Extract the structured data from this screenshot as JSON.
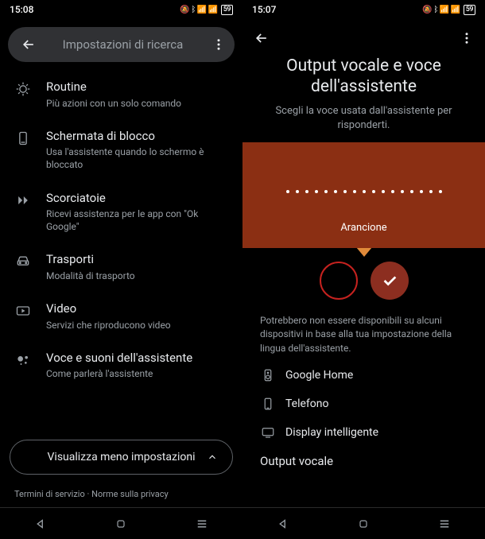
{
  "left": {
    "status": {
      "time": "15:08",
      "battery": "59"
    },
    "search_title": "Impostazioni di ricerca",
    "items": [
      {
        "icon": "routines",
        "title": "Routine",
        "subtitle": "Più azioni con un solo comando"
      },
      {
        "icon": "lock-screen",
        "title": "Schermata di blocco",
        "subtitle": "Usa l'assistente quando lo schermo è bloccato"
      },
      {
        "icon": "shortcuts",
        "title": "Scorciatoie",
        "subtitle": "Ricevi assistenza per le app con \"Ok Google\""
      },
      {
        "icon": "car",
        "title": "Trasporti",
        "subtitle": "Modalità di trasporto"
      },
      {
        "icon": "video",
        "title": "Video",
        "subtitle": "Servizi che riproducono video"
      },
      {
        "icon": "assistant-voice",
        "title": "Voce e suoni dell'assistente",
        "subtitle": "Come parlerà l'assistente"
      }
    ],
    "expand_label": "Visualizza meno impostazioni",
    "footer": {
      "terms": "Termini di servizio",
      "sep": " · ",
      "privacy": "Norme sulla privacy"
    }
  },
  "right": {
    "status": {
      "time": "15:07",
      "battery": "59"
    },
    "title": "Output vocale e voce dell'assistente",
    "subtitle": "Scegli la voce usata dall'assistente per risponderti.",
    "voice_label": "Arancione",
    "voice_color": "#8b2f13",
    "note": "Potrebbero non essere disponibili su alcuni dispositivi in base alla tua impostazione della lingua dell'assistente.",
    "devices": [
      {
        "icon": "speaker",
        "label": "Google Home"
      },
      {
        "icon": "phone",
        "label": "Telefono"
      },
      {
        "icon": "display",
        "label": "Display intelligente"
      }
    ],
    "next_section": "Output vocale"
  }
}
